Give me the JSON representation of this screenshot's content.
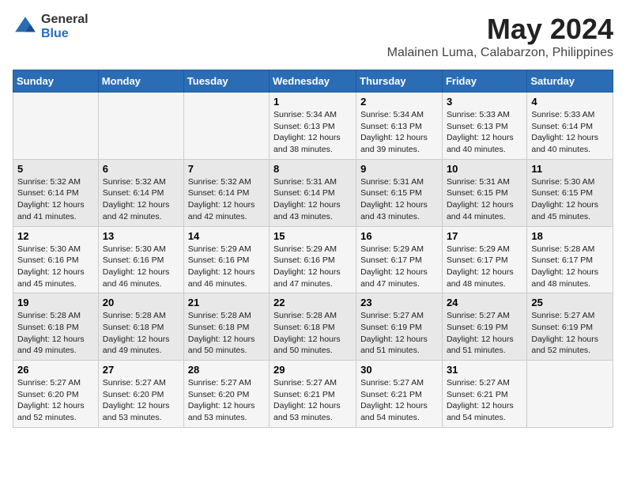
{
  "logo": {
    "general": "General",
    "blue": "Blue"
  },
  "header": {
    "title": "May 2024",
    "subtitle": "Malainen Luma, Calabarzon, Philippines"
  },
  "days_of_week": [
    "Sunday",
    "Monday",
    "Tuesday",
    "Wednesday",
    "Thursday",
    "Friday",
    "Saturday"
  ],
  "weeks": [
    [
      {
        "day": "",
        "info": ""
      },
      {
        "day": "",
        "info": ""
      },
      {
        "day": "",
        "info": ""
      },
      {
        "day": "1",
        "info": "Sunrise: 5:34 AM\nSunset: 6:13 PM\nDaylight: 12 hours\nand 38 minutes."
      },
      {
        "day": "2",
        "info": "Sunrise: 5:34 AM\nSunset: 6:13 PM\nDaylight: 12 hours\nand 39 minutes."
      },
      {
        "day": "3",
        "info": "Sunrise: 5:33 AM\nSunset: 6:13 PM\nDaylight: 12 hours\nand 40 minutes."
      },
      {
        "day": "4",
        "info": "Sunrise: 5:33 AM\nSunset: 6:14 PM\nDaylight: 12 hours\nand 40 minutes."
      }
    ],
    [
      {
        "day": "5",
        "info": "Sunrise: 5:32 AM\nSunset: 6:14 PM\nDaylight: 12 hours\nand 41 minutes."
      },
      {
        "day": "6",
        "info": "Sunrise: 5:32 AM\nSunset: 6:14 PM\nDaylight: 12 hours\nand 42 minutes."
      },
      {
        "day": "7",
        "info": "Sunrise: 5:32 AM\nSunset: 6:14 PM\nDaylight: 12 hours\nand 42 minutes."
      },
      {
        "day": "8",
        "info": "Sunrise: 5:31 AM\nSunset: 6:14 PM\nDaylight: 12 hours\nand 43 minutes."
      },
      {
        "day": "9",
        "info": "Sunrise: 5:31 AM\nSunset: 6:15 PM\nDaylight: 12 hours\nand 43 minutes."
      },
      {
        "day": "10",
        "info": "Sunrise: 5:31 AM\nSunset: 6:15 PM\nDaylight: 12 hours\nand 44 minutes."
      },
      {
        "day": "11",
        "info": "Sunrise: 5:30 AM\nSunset: 6:15 PM\nDaylight: 12 hours\nand 45 minutes."
      }
    ],
    [
      {
        "day": "12",
        "info": "Sunrise: 5:30 AM\nSunset: 6:16 PM\nDaylight: 12 hours\nand 45 minutes."
      },
      {
        "day": "13",
        "info": "Sunrise: 5:30 AM\nSunset: 6:16 PM\nDaylight: 12 hours\nand 46 minutes."
      },
      {
        "day": "14",
        "info": "Sunrise: 5:29 AM\nSunset: 6:16 PM\nDaylight: 12 hours\nand 46 minutes."
      },
      {
        "day": "15",
        "info": "Sunrise: 5:29 AM\nSunset: 6:16 PM\nDaylight: 12 hours\nand 47 minutes."
      },
      {
        "day": "16",
        "info": "Sunrise: 5:29 AM\nSunset: 6:17 PM\nDaylight: 12 hours\nand 47 minutes."
      },
      {
        "day": "17",
        "info": "Sunrise: 5:29 AM\nSunset: 6:17 PM\nDaylight: 12 hours\nand 48 minutes."
      },
      {
        "day": "18",
        "info": "Sunrise: 5:28 AM\nSunset: 6:17 PM\nDaylight: 12 hours\nand 48 minutes."
      }
    ],
    [
      {
        "day": "19",
        "info": "Sunrise: 5:28 AM\nSunset: 6:18 PM\nDaylight: 12 hours\nand 49 minutes."
      },
      {
        "day": "20",
        "info": "Sunrise: 5:28 AM\nSunset: 6:18 PM\nDaylight: 12 hours\nand 49 minutes."
      },
      {
        "day": "21",
        "info": "Sunrise: 5:28 AM\nSunset: 6:18 PM\nDaylight: 12 hours\nand 50 minutes."
      },
      {
        "day": "22",
        "info": "Sunrise: 5:28 AM\nSunset: 6:18 PM\nDaylight: 12 hours\nand 50 minutes."
      },
      {
        "day": "23",
        "info": "Sunrise: 5:27 AM\nSunset: 6:19 PM\nDaylight: 12 hours\nand 51 minutes."
      },
      {
        "day": "24",
        "info": "Sunrise: 5:27 AM\nSunset: 6:19 PM\nDaylight: 12 hours\nand 51 minutes."
      },
      {
        "day": "25",
        "info": "Sunrise: 5:27 AM\nSunset: 6:19 PM\nDaylight: 12 hours\nand 52 minutes."
      }
    ],
    [
      {
        "day": "26",
        "info": "Sunrise: 5:27 AM\nSunset: 6:20 PM\nDaylight: 12 hours\nand 52 minutes."
      },
      {
        "day": "27",
        "info": "Sunrise: 5:27 AM\nSunset: 6:20 PM\nDaylight: 12 hours\nand 53 minutes."
      },
      {
        "day": "28",
        "info": "Sunrise: 5:27 AM\nSunset: 6:20 PM\nDaylight: 12 hours\nand 53 minutes."
      },
      {
        "day": "29",
        "info": "Sunrise: 5:27 AM\nSunset: 6:21 PM\nDaylight: 12 hours\nand 53 minutes."
      },
      {
        "day": "30",
        "info": "Sunrise: 5:27 AM\nSunset: 6:21 PM\nDaylight: 12 hours\nand 54 minutes."
      },
      {
        "day": "31",
        "info": "Sunrise: 5:27 AM\nSunset: 6:21 PM\nDaylight: 12 hours\nand 54 minutes."
      },
      {
        "day": "",
        "info": ""
      }
    ]
  ]
}
